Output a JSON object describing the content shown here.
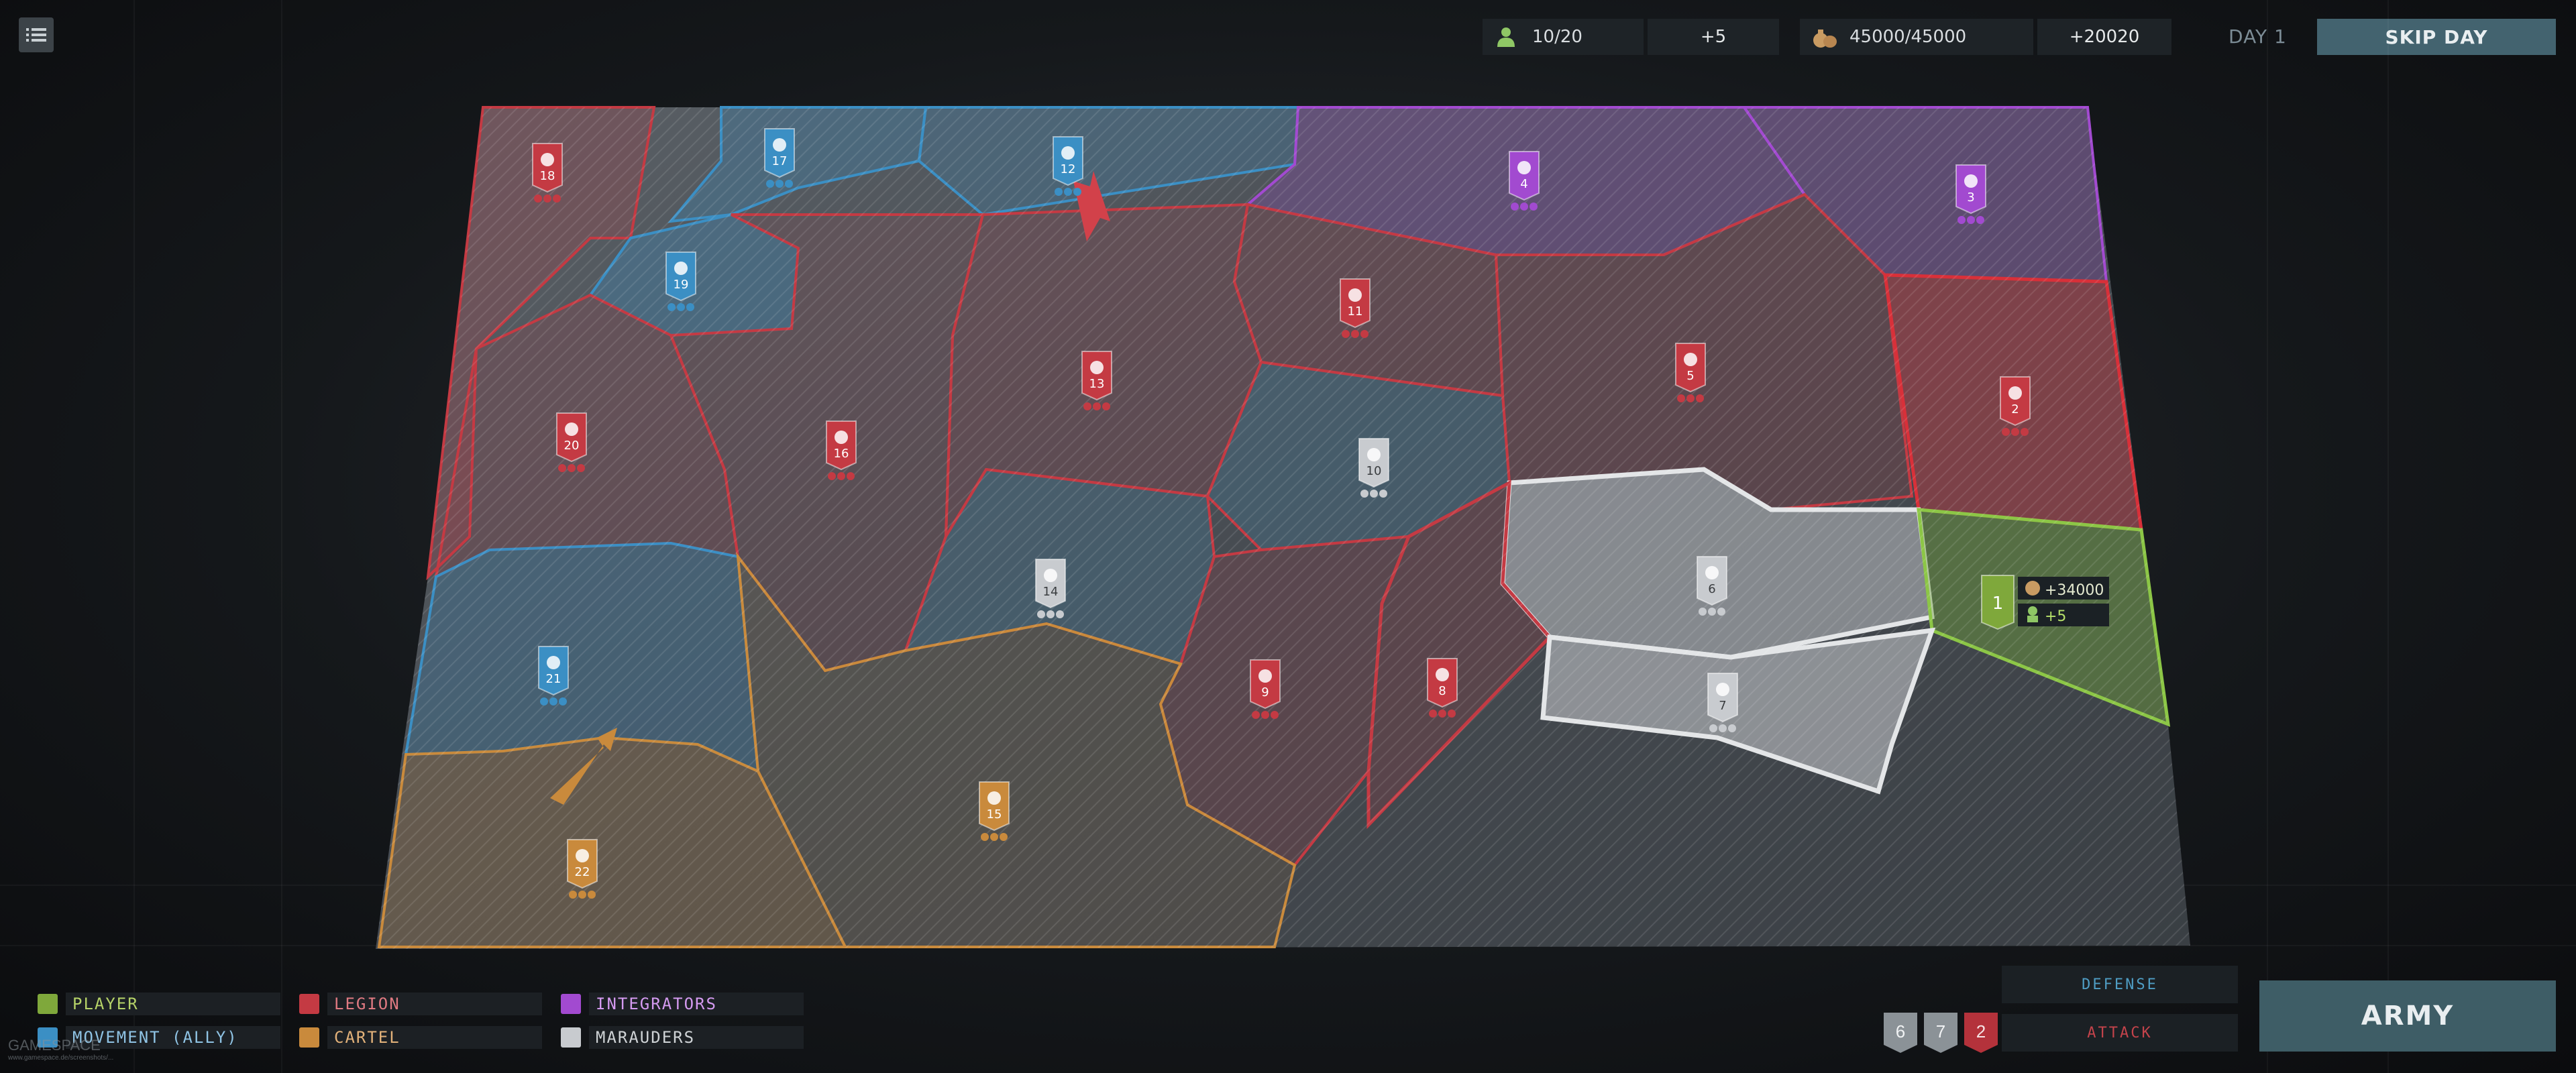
{
  "top_bar": {
    "units": "10/20",
    "units_gain": "+5",
    "money": "45000/45000",
    "money_gain": "+20020",
    "day": "DAY 1",
    "skip_day": "SKIP DAY"
  },
  "icons": {
    "menu": "list-icon",
    "units": "soldier-icon",
    "money": "money-bag-icon"
  },
  "factions": {
    "player": {
      "color": "#7fa83b"
    },
    "movement": {
      "color": "#3b8fc4"
    },
    "legion": {
      "color": "#c43a43"
    },
    "cartel": {
      "color": "#c98a3c"
    },
    "integrators": {
      "color": "#a24ad0"
    },
    "marauders": {
      "color": "#c8cbcf"
    }
  },
  "regions": [
    {
      "id": "18",
      "label": "18",
      "faction": "legion",
      "pips": 3
    },
    {
      "id": "17",
      "label": "17",
      "faction": "movement",
      "pips": 3
    },
    {
      "id": "12",
      "label": "12",
      "faction": "movement",
      "pips": 3
    },
    {
      "id": "4",
      "label": "4",
      "faction": "integrators",
      "pips": 3
    },
    {
      "id": "3",
      "label": "3",
      "faction": "integrators",
      "pips": 3
    },
    {
      "id": "19",
      "label": "19",
      "faction": "movement",
      "pips": 3
    },
    {
      "id": "11",
      "label": "11",
      "faction": "legion",
      "pips": 3
    },
    {
      "id": "13",
      "label": "13",
      "faction": "legion",
      "pips": 3
    },
    {
      "id": "5",
      "label": "5",
      "faction": "legion",
      "pips": 3
    },
    {
      "id": "2",
      "label": "2",
      "faction": "legion",
      "pips": 3
    },
    {
      "id": "20",
      "label": "20",
      "faction": "legion",
      "pips": 3
    },
    {
      "id": "16",
      "label": "16",
      "faction": "legion",
      "pips": 3
    },
    {
      "id": "10",
      "label": "10",
      "faction": "marauders",
      "pips": 3
    },
    {
      "id": "14",
      "label": "14",
      "faction": "marauders",
      "pips": 3
    },
    {
      "id": "6",
      "label": "6",
      "faction": "marauders",
      "pips": 3
    },
    {
      "id": "1",
      "label": "1",
      "faction": "player",
      "pips": 0
    },
    {
      "id": "21",
      "label": "21",
      "faction": "movement",
      "pips": 3
    },
    {
      "id": "9",
      "label": "9",
      "faction": "legion",
      "pips": 3
    },
    {
      "id": "8",
      "label": "8",
      "faction": "legion",
      "pips": 3
    },
    {
      "id": "7",
      "label": "7",
      "faction": "marauders",
      "pips": 3
    },
    {
      "id": "15",
      "label": "15",
      "faction": "cartel",
      "pips": 3
    },
    {
      "id": "22",
      "label": "22",
      "faction": "cartel",
      "pips": 3
    }
  ],
  "player_region_info": {
    "money_gain": "+34000",
    "units_gain": "+5"
  },
  "legend": [
    {
      "key": "player",
      "label": "PLAYER"
    },
    {
      "key": "movement",
      "label": "MOVEMENT (ALLY)"
    },
    {
      "key": "legion",
      "label": "LEGION"
    },
    {
      "key": "cartel",
      "label": "CARTEL"
    },
    {
      "key": "integrators",
      "label": "INTEGRATORS"
    },
    {
      "key": "marauders",
      "label": "MARAUDERS"
    }
  ],
  "army_panel": {
    "defense_label": "DEFENSE",
    "attack_label": "ATTACK",
    "army_button": "ARMY",
    "attack_cards": [
      "6",
      "7",
      "2"
    ]
  },
  "watermark": {
    "brand": "GAMESPACE",
    "url": "www.gamespace.de/screenshots/..."
  }
}
